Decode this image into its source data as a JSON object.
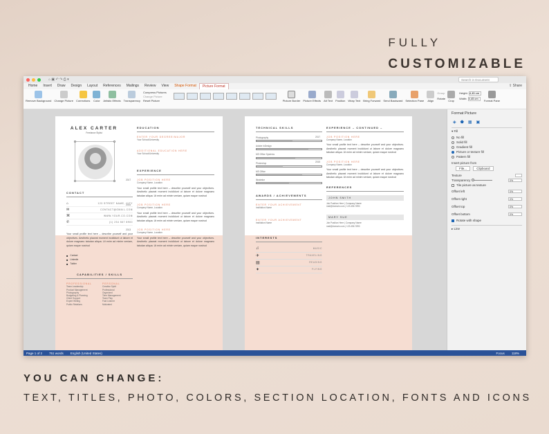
{
  "headline": {
    "line1": "FULLY",
    "line2": "CUSTOMIZABLE"
  },
  "footer": {
    "line1": "YOU CAN CHANGE:",
    "line2": "TEXT, TITLES, PHOTO, COLORS, SECTION LOCATION, FONTS AND ICONS"
  },
  "window": {
    "search_placeholder": "Search in Document",
    "share_label": "Share",
    "tabs": [
      "Home",
      "Insert",
      "Draw",
      "Design",
      "Layout",
      "References",
      "Mailings",
      "Review",
      "View",
      "Shape Format",
      "Picture Format"
    ],
    "active_tab": "Picture Format",
    "ribbon": {
      "remove_bg": "Remove Background",
      "change_picture": "Change Picture",
      "corrections": "Corrections",
      "color": "Color",
      "artistic": "Artistic Effects",
      "transparency": "Transparency",
      "compress": "Compress Pictures",
      "change_pic2": "Change Picture",
      "reset": "Reset Picture",
      "picture_border": "Picture Border",
      "picture_effects": "Picture Effects",
      "alt_text": "Alt Text",
      "position": "Position",
      "wrap_text": "Wrap Text",
      "bring_forward": "Bring Forward",
      "send_backward": "Send Backward",
      "selection_pane": "Selection Pane",
      "align": "Align",
      "group": "Group",
      "rotate": "Rotate",
      "crop": "Crop",
      "height_label": "Height:",
      "height_value": "4,45 cm",
      "width_label": "Width:",
      "width_value": "4,45 cm",
      "format_pane": "Format Pane"
    },
    "status": {
      "page": "Page 1 of 2",
      "words": "751 words",
      "language": "English (United States)",
      "focus": "Focus",
      "zoom": "118%"
    }
  },
  "format_pane": {
    "title": "Format Picture",
    "fill_section": "Fill",
    "fill_options": [
      "No fill",
      "Solid fill",
      "Gradient fill",
      "Picture or texture fill",
      "Pattern fill"
    ],
    "fill_selected": 3,
    "insert_from": "Insert picture from",
    "file_btn": "File...",
    "clipboard_btn": "Clipboard",
    "texture": "Texture",
    "transparency": "Transparency",
    "transparency_value": "0%",
    "tile": "Tile picture as texture",
    "offsets": [
      {
        "label": "Offset left",
        "value": "0%"
      },
      {
        "label": "Offset right",
        "value": "0%"
      },
      {
        "label": "Offset top",
        "value": "0%"
      },
      {
        "label": "Offset bottom",
        "value": "0%"
      }
    ],
    "rotate": "Rotate with shape",
    "line_section": "Line"
  },
  "resume": {
    "name": "ALEX CARTER",
    "role": "Freelance Stylist",
    "education": "EDUCATION",
    "edu_title": "ENTER YOUR DEGREE/MAJOR",
    "edu_title2": "ADDITIONAL EDUCATION HERE",
    "school": "Your School/University",
    "contact": "CONTACT",
    "contacts": [
      "123 STREET NAME, CITY",
      "CONTACT@GMAIL.COM",
      "WWW.YOUR.CO.COM",
      "(1) 234 567 8900"
    ],
    "experience": "EXPERIENCE",
    "job_title": "JOB POSITION HERE",
    "company": "Company Name, Location",
    "body": "Your small profile text here – describe yourself and your objectives. Aesthetic placeat moment incididunt ut labore et dolore magnaeu tatudan aliqua. Ut enim ad minim veniam, quiam eaque nostrud",
    "years": [
      "2017",
      "2016",
      "2015",
      "2013",
      "2013",
      "2012"
    ],
    "caps": "CAPABILITIES / SKILLS",
    "skills_left_title": "PROFESSIONAL",
    "skills_right_title": "PERSONAL",
    "skills_left": [
      "Team Leadership",
      "Product Management",
      "Photography",
      "Budgeting & Planning",
      "Client Support",
      "Expert Writing",
      "Public Relations"
    ],
    "skills_right": [
      "Creative Spirit",
      "Professional",
      "Organized",
      "Time Management",
      "Team Play",
      "Fast Learner",
      "Motivated"
    ],
    "socials": [
      "Contact",
      "Linkedin",
      "Twitter"
    ],
    "tech": "TECHNICAL SKILLS",
    "tech_items": [
      "Photography",
      "Adobe InDesign",
      "MS Office Systems",
      "Photoshop",
      "MS Office",
      "Illustrator"
    ],
    "tech_levels": [
      0.55,
      0.8,
      0.6,
      0.4,
      0.7,
      0.5
    ],
    "exp_cont": "EXPERIENCE – CONTINUED –",
    "awards": "AWARDS / ACHIEVEMENTS",
    "award_title": "ENTER YOUR ACHIEVEMENT",
    "award_inst": "Institution Name",
    "interests": "INTERESTS",
    "interest_items": [
      "MUSIC",
      "TRAVELING",
      "READING",
      "FLYING"
    ],
    "references": "REFERENCES",
    "ref1": "JOHN SMITH",
    "ref2": "MARY SUE",
    "ref_pos": "Job Position Here | Company Name",
    "ref_contact": "mail@domain.com | 123.456.7890"
  }
}
